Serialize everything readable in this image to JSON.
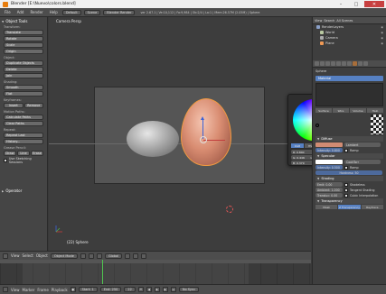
{
  "titlebar": {
    "title": "Blender [E:\\Nuevo\\colors.blend]"
  },
  "infobar": {
    "menus": [
      "File",
      "Add",
      "Render",
      "Help"
    ],
    "layout": "Default",
    "scene": "Scene",
    "engine": "Blender Render",
    "stats": "ver 2.67.1 | Ve:10,112 | Fa:9,984 | Ob:2/4 | La:1 | Mem:26.57M (2.05M) | Sphere"
  },
  "toolshelf": {
    "title": "Object Tools",
    "transform_label": "Transform:",
    "transform_buttons": [
      "Translate",
      "Rotate",
      "Scale",
      "Origin"
    ],
    "object_label": "Object:",
    "object_buttons": [
      "Duplicate Objects",
      "Delete",
      "Join"
    ],
    "shading_label": "Shading:",
    "shading_buttons": [
      "Smooth",
      "Flat"
    ],
    "keyframes_label": "Keyframes:",
    "keyframe_insert": "Insert",
    "keyframe_remove": "Remove",
    "motion_paths_label": "Motion Paths:",
    "motion_paths_buttons": [
      "Calculate Paths",
      "Clear Paths"
    ],
    "repeat_label": "Repeat:",
    "repeat_buttons": [
      "Repeat Last",
      "History..."
    ],
    "grease_pencil_label": "Grease Pencil:",
    "grease_buttons": [
      "Draw",
      "Line",
      "Erase"
    ],
    "use_sketching": "Use Sketching Sessions",
    "operator_title": "Operator"
  },
  "viewport": {
    "label": "Camera Persp",
    "selected_label": "(22) Sphere"
  },
  "color_picker": {
    "modes": [
      "RGB",
      "HSV",
      "Hex"
    ],
    "active_mode": "RGB",
    "r": "R: 0.800",
    "g": "G: 0.446",
    "b": "B: 0.379",
    "hint": "Gamma corrected",
    "color": "#d08b73"
  },
  "vp_header": {
    "menus": [
      "View",
      "Select",
      "Object"
    ],
    "mode": "Object Mode",
    "pivot": "Global"
  },
  "timeline_header": {
    "menus": [
      "View",
      "Marker",
      "Frame",
      "Playback"
    ],
    "start": "Start: 1",
    "end": "End: 250",
    "current": "22",
    "sync": "No Sync"
  },
  "outliner": {
    "menus": [
      "View",
      "Search"
    ],
    "scope": "All Scenes",
    "items": [
      {
        "label": "RenderLayers",
        "color": "#8aa0c8"
      },
      {
        "label": "World",
        "color": "#b8c8a0"
      },
      {
        "label": "Camera",
        "color": "#aaaaaa"
      },
      {
        "label": "Plane",
        "color": "#ee9955"
      }
    ]
  },
  "properties": {
    "context_object": "Sphere",
    "material_slot": "Material",
    "subtabs": [
      "Surface",
      "Wire",
      "Volume",
      "Halo"
    ],
    "diffuse_title": "Diffuse",
    "diffuse_shader": "Lambert",
    "intensity": "Intensity: 0.800",
    "ramp_label": "Ramp",
    "specular_title": "Specular",
    "specular_shader": "CookTorr",
    "spec_intensity": "Intensity: 0.500",
    "hardness": "Hardness: 50",
    "shading_title": "Shading",
    "emit": "Emit: 0.00",
    "ambient": "Ambient: 1.000",
    "translucency": "Transluc: 0.00",
    "shadeless": "Shadeless",
    "tangent_shading": "Tangent Shading",
    "cubic": "Cubic Interpolation",
    "transparency_title": "Transparency",
    "trans_modes": [
      "Mask",
      "Z Transparency",
      "Raytrace"
    ],
    "diffuse_color": "#d08b73",
    "specular_color": "#ffffff"
  }
}
